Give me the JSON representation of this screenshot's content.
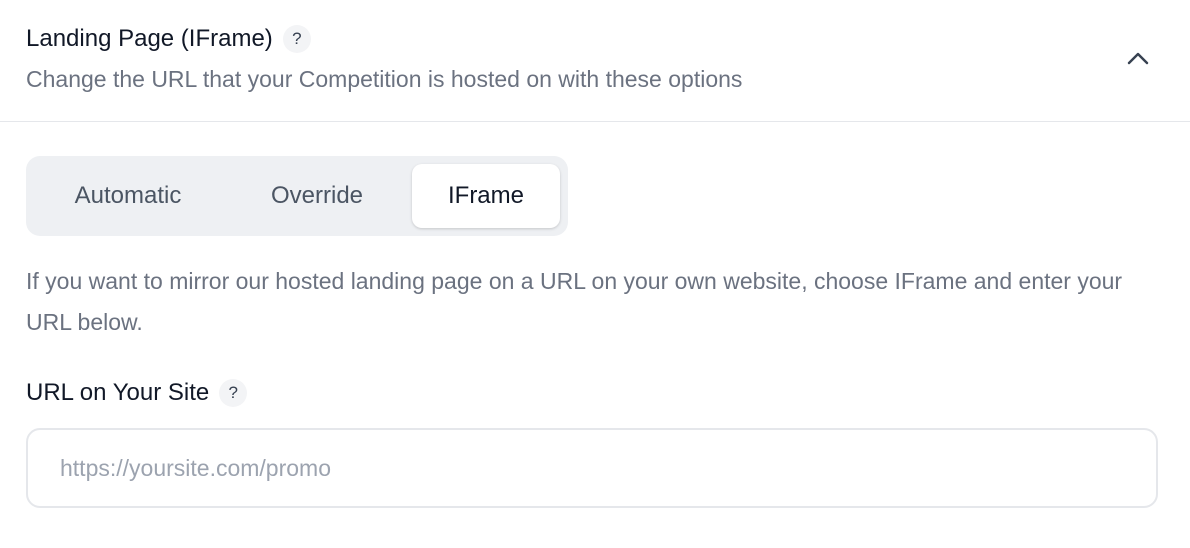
{
  "section": {
    "title": "Landing Page (IFrame)",
    "help_glyph": "?",
    "subtitle": "Change the URL that your Competition is hosted on with these options",
    "collapse_icon": "chevron-up-icon"
  },
  "tabs": {
    "items": [
      {
        "label": "Automatic",
        "selected": false
      },
      {
        "label": "Override",
        "selected": false
      },
      {
        "label": "IFrame",
        "selected": true
      }
    ]
  },
  "description": "If you want to mirror our hosted landing page on a URL on your own website, choose IFrame and enter your URL below.",
  "url_field": {
    "label": "URL on Your Site",
    "help_glyph": "?",
    "value": "",
    "placeholder": "https://yoursite.com/promo"
  },
  "colors": {
    "text_primary": "#111827",
    "text_secondary": "#6b7280",
    "tab_track": "#eef0f3",
    "border": "#e5e7eb"
  }
}
